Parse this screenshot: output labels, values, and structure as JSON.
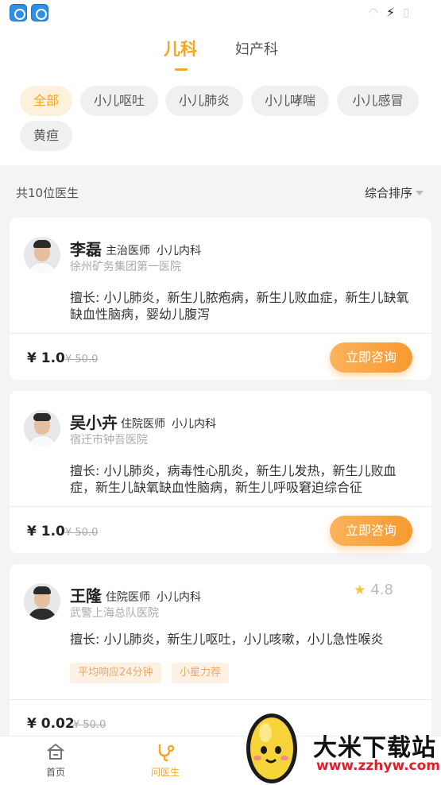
{
  "department_tabs": [
    {
      "label": "儿科",
      "active": true
    },
    {
      "label": "妇产科",
      "active": false
    }
  ],
  "filter_chips": [
    {
      "label": "全部",
      "active": true
    },
    {
      "label": "小儿呕吐",
      "active": false
    },
    {
      "label": "小儿肺炎",
      "active": false
    },
    {
      "label": "小儿哮喘",
      "active": false
    },
    {
      "label": "小儿感冒",
      "active": false
    },
    {
      "label": "黄疸",
      "active": false
    }
  ],
  "list_header": {
    "count_text": "共10位医生",
    "sort_label": "综合排序"
  },
  "doctors": [
    {
      "name": "李磊",
      "title": "主治医师",
      "dept": "小儿内科",
      "hospital": "徐州矿务集团第一医院",
      "skill": "擅长: 小儿肺炎，新生儿脓疱病，新生儿败血症，新生儿缺氧缺血性脑病，婴幼儿腹泻",
      "price": "¥ 1.0",
      "old_price": "¥ 50.0",
      "button": "立即咨询"
    },
    {
      "name": "吴小卉",
      "title": "住院医师",
      "dept": "小儿内科",
      "hospital": "宿迁市钟吾医院",
      "skill": "擅长: 小儿肺炎，病毒性心肌炎，新生儿发热，新生儿败血症，新生儿缺氧缺血性脑病，新生儿呼吸窘迫综合征",
      "price": "¥ 1.0",
      "old_price": "¥ 50.0",
      "button": "立即咨询"
    },
    {
      "name": "王隆",
      "title": "住院医师",
      "dept": "小儿内科",
      "hospital": "武警上海总队医院",
      "rating": "4.8",
      "skill": "擅长: 小儿肺炎，新生儿呕吐，小儿咳嗽，小儿急性喉炎",
      "tags": [
        "平均响应24分钟",
        "小星力荐"
      ],
      "price": "¥ 0.02",
      "old_price": "¥ 50.0"
    }
  ],
  "bottom_nav": [
    {
      "label": "首页",
      "icon": "home-icon",
      "active": false
    },
    {
      "label": "问医生",
      "icon": "stethoscope-icon",
      "active": true
    }
  ],
  "watermark": {
    "title": "大米下载站",
    "url": "www.zzhyw.com"
  },
  "colors": {
    "accent": "#f5a623",
    "button_gradient_start": "#fbb35c",
    "button_gradient_end": "#f7992f",
    "chip_active_bg": "#fdf0dc",
    "watermark_url": "#d8222b"
  }
}
